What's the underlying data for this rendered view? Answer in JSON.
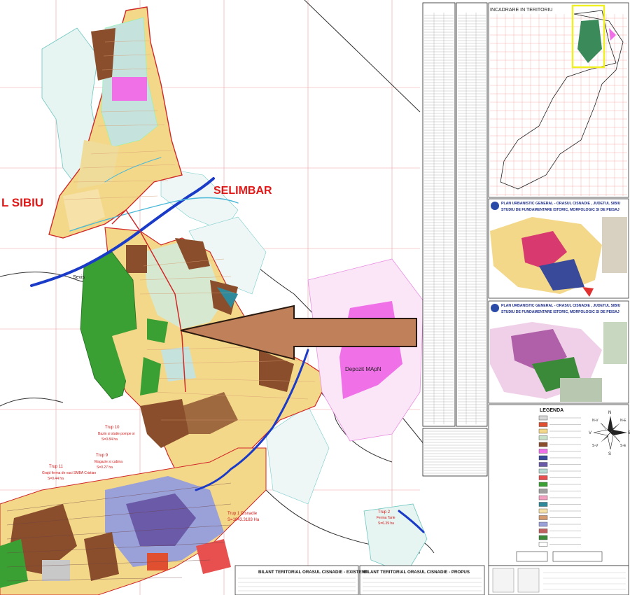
{
  "map": {
    "labels": {
      "left_sibiu": "L SIBIU",
      "selimbar": "SELIMBAR",
      "river": "Sevis",
      "depozit": "Depozit MApN",
      "trup10": [
        "Trup 10",
        "Bazin si statie pompe si",
        "S=0.84 ha"
      ],
      "trup9": [
        "Trup 9",
        "Magazie si cabina",
        "S=0.27 ha"
      ],
      "trup11": [
        "Trup 11",
        "Grajd ferma de vaci SMBA Cristian",
        "S=0.44 ha"
      ],
      "trup1": [
        "Trup 1 Cisnadie",
        "S=1043.3183 Ha"
      ],
      "trup2": [
        "Trup 2",
        "Ferma Tarle",
        "S=6.39 ha"
      ]
    }
  },
  "inset": {
    "title": "INCADRARE IN TERITORIU"
  },
  "study_panels": [
    {
      "title": "PLAN URBANISTIC GENERAL - ORASUL CISNADIE , JUDETUL SIBIU",
      "subtitle": "STUDIU DE FUNDAMENTARE ISTORIC, MORFOLOGIC SI DE PEISAJ"
    },
    {
      "title": "PLAN URBANISTIC GENERAL - ORASUL CISNADIE , JUDETUL SIBIU",
      "subtitle": "STUDIU DE FUNDAMENTARE ISTORIC, MORFOLOGIC SI DE PEISAJ"
    }
  ],
  "legend": {
    "title": "LEGENDA",
    "compass": {
      "n": "N",
      "s": "S",
      "e": "E",
      "v": "V",
      "ne": "N-E",
      "nv": "N-V",
      "se": "S-E",
      "sv": "S-V"
    }
  },
  "bilant": {
    "existent_title": "BILANT TERITORIAL ORASUL CISNADIE - EXISTENT",
    "propus_title": "BILANT TERITORIAL ORASUL CISNADIE - PROPUS"
  },
  "colors": {
    "yellow": "#f4d88a",
    "brown": "#8a4e2c",
    "green": "#3aa034",
    "teal": "#b8dcd4",
    "magenta": "#f070e8",
    "arrow": "#c0805a",
    "river": "#1a3ac8",
    "boundary": "#d02828"
  }
}
